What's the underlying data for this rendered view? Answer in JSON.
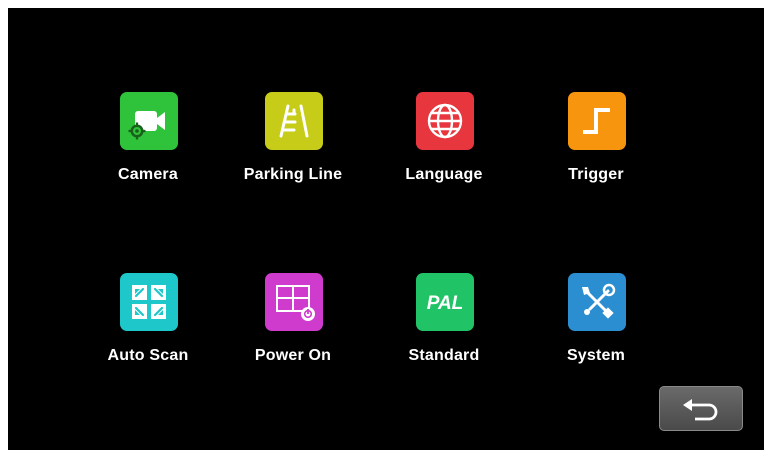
{
  "menu": {
    "items": [
      {
        "label": "Camera",
        "icon": "camera-icon",
        "color": "#2fc33b"
      },
      {
        "label": "Parking Line",
        "icon": "parking-line-icon",
        "color": "#c6cc17"
      },
      {
        "label": "Language",
        "icon": "globe-icon",
        "color": "#e8363e"
      },
      {
        "label": "Trigger",
        "icon": "trigger-icon",
        "color": "#f7950f"
      },
      {
        "label": "Auto Scan",
        "icon": "auto-scan-icon",
        "color": "#1ec7c9"
      },
      {
        "label": "Power On",
        "icon": "power-on-icon",
        "color": "#cf3ccd"
      },
      {
        "label": "Standard",
        "icon": "pal-icon",
        "icon_text": "PAL",
        "color": "#20c467"
      },
      {
        "label": "System",
        "icon": "tools-icon",
        "color": "#2a8ed0"
      }
    ]
  },
  "back_button": {
    "icon": "back-arrow-icon"
  }
}
